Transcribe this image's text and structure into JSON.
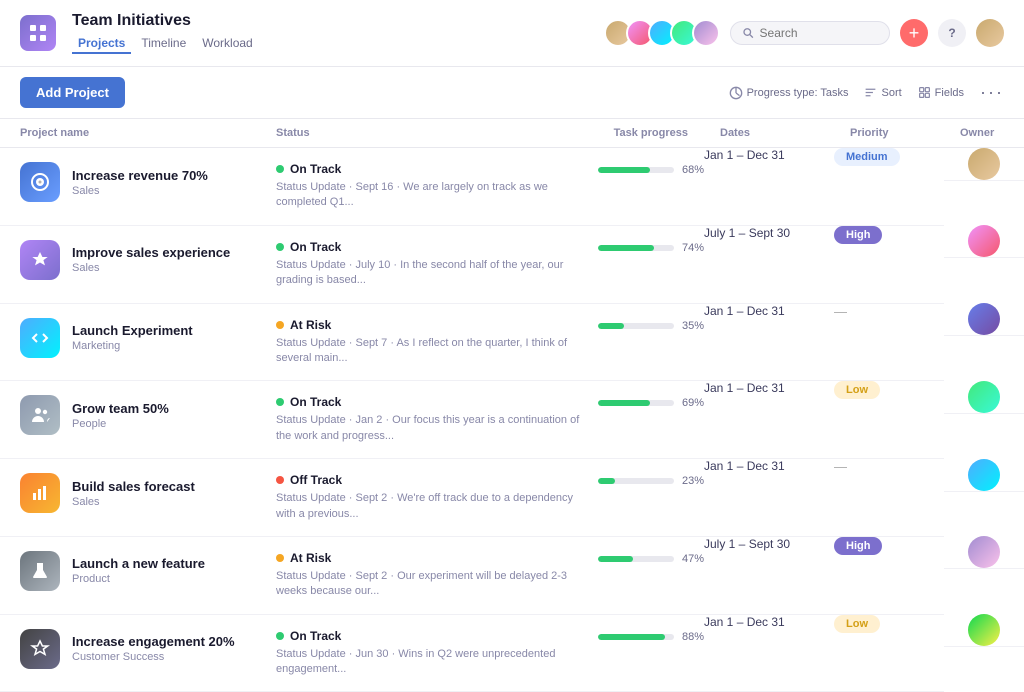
{
  "app": {
    "icon_label": "grid-icon",
    "title": "Team Initiatives",
    "nav": [
      {
        "label": "Projects",
        "active": true
      },
      {
        "label": "Timeline",
        "active": false
      },
      {
        "label": "Workload",
        "active": false
      }
    ]
  },
  "header": {
    "search_placeholder": "Search",
    "add_icon_label": "+",
    "question_icon_label": "?"
  },
  "toolbar": {
    "add_project_label": "Add Project",
    "progress_type_label": "Progress type: Tasks",
    "sort_label": "Sort",
    "fields_label": "Fields"
  },
  "table": {
    "columns": [
      "Project name",
      "Status",
      "Task progress",
      "Dates",
      "Priority",
      "Owner"
    ],
    "rows": [
      {
        "id": 1,
        "icon_type": "target",
        "icon_color": "icon-blue",
        "name": "Increase revenue 70%",
        "team": "Sales",
        "status": "On Track",
        "status_type": "green",
        "status_update": "Status Update · Sept 16 · We are largely on track as we completed Q1...",
        "progress": 68,
        "dates": "Jan 1 – Dec 31",
        "priority": "Medium",
        "priority_type": "medium",
        "owner_color": "av-brown"
      },
      {
        "id": 2,
        "icon_type": "star",
        "icon_color": "icon-purple",
        "name": "Improve sales experience",
        "team": "Sales",
        "status": "On Track",
        "status_type": "green",
        "status_update": "Status Update · July 10 · In the second half of the year, our grading is based...",
        "progress": 74,
        "dates": "July 1 – Sept 30",
        "priority": "High",
        "priority_type": "high",
        "owner_color": "av-pink"
      },
      {
        "id": 3,
        "icon_type": "code",
        "icon_color": "icon-teal",
        "name": "Launch Experiment",
        "team": "Marketing",
        "status": "At Risk",
        "status_type": "yellow",
        "status_update": "Status Update · Sept 7 · As I reflect on the quarter, I think of several main...",
        "progress": 35,
        "dates": "Jan 1 – Dec 31",
        "priority": "—",
        "priority_type": "none",
        "owner_color": "av-slate"
      },
      {
        "id": 4,
        "icon_type": "people",
        "icon_color": "icon-gray",
        "name": "Grow team 50%",
        "team": "People",
        "status": "On Track",
        "status_type": "green",
        "status_update": "Status Update · Jan 2 · Our focus this year is a continuation of the work and progress...",
        "progress": 69,
        "dates": "Jan 1 – Dec 31",
        "priority": "Low",
        "priority_type": "low",
        "owner_color": "av-green"
      },
      {
        "id": 5,
        "icon_type": "chart",
        "icon_color": "icon-orange",
        "name": "Build sales forecast",
        "team": "Sales",
        "status": "Off Track",
        "status_type": "red",
        "status_update": "Status Update · Sept 2 · We're off track due to a dependency with a previous...",
        "progress": 23,
        "dates": "Jan 1 – Dec 31",
        "priority": "—",
        "priority_type": "none",
        "owner_color": "av-blue"
      },
      {
        "id": 6,
        "icon_type": "flask",
        "icon_color": "icon-darkgray",
        "name": "Launch a new feature",
        "team": "Product",
        "status": "At Risk",
        "status_type": "yellow",
        "status_update": "Status Update · Sept 2 · Our experiment will be delayed 2-3 weeks because our...",
        "progress": 47,
        "dates": "July 1 – Sept 30",
        "priority": "High",
        "priority_type": "high",
        "owner_color": "av-purple"
      },
      {
        "id": 7,
        "icon_type": "star2",
        "icon_color": "icon-dark",
        "name": "Increase engagement 20%",
        "team": "Customer Success",
        "status": "On Track",
        "status_type": "green",
        "status_update": "Status Update · Jun 30 · Wins in Q2 were unprecedented engagement...",
        "progress": 88,
        "dates": "Jan 1 – Dec 31",
        "priority": "Low",
        "priority_type": "low",
        "owner_color": "av-teal"
      }
    ]
  }
}
